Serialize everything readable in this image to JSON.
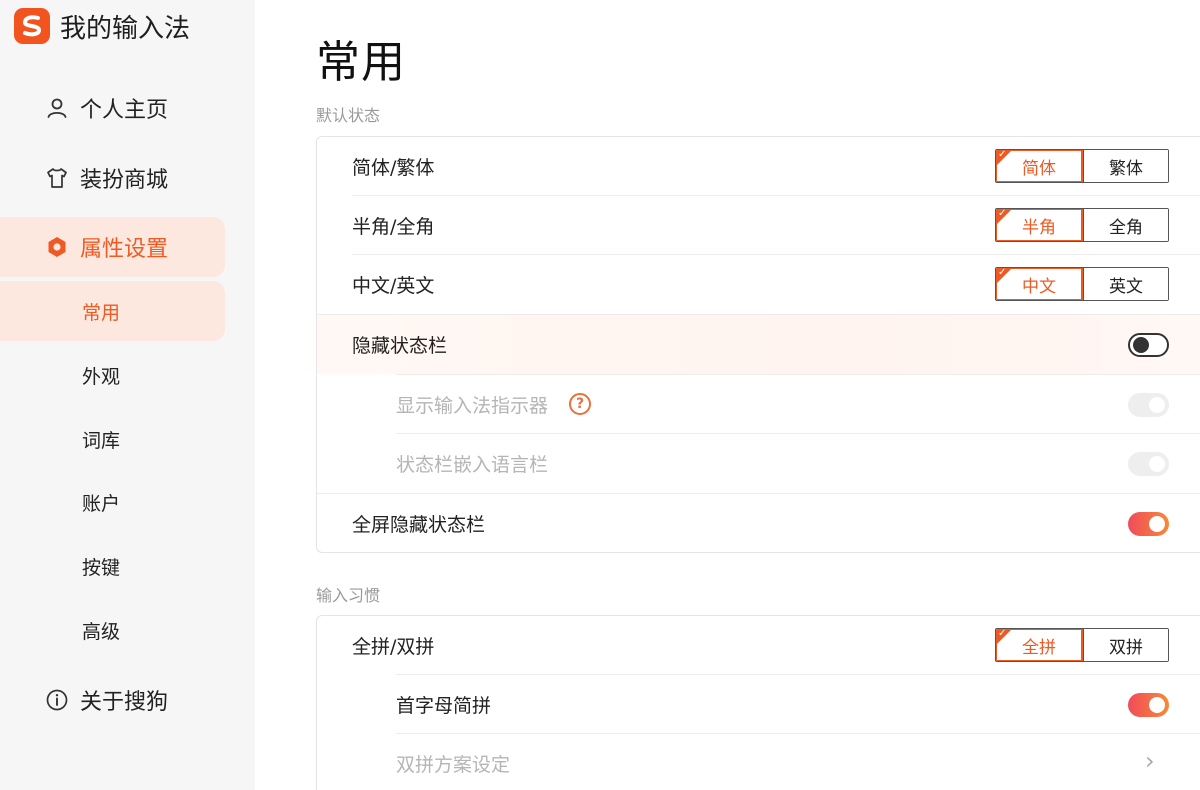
{
  "app": {
    "title": "我的输入法"
  },
  "sidebar": {
    "items": [
      {
        "label": "个人主页",
        "icon": "user-icon"
      },
      {
        "label": "装扮商城",
        "icon": "shirt-icon"
      },
      {
        "label": "属性设置",
        "icon": "hexagon-settings-icon"
      }
    ],
    "sub_items": [
      "常用",
      "外观",
      "词库",
      "账户",
      "按键",
      "高级"
    ],
    "about": {
      "label": "关于搜狗",
      "icon": "info-icon"
    }
  },
  "main": {
    "title": "常用",
    "sections": [
      {
        "label": "默认状态",
        "rows": [
          {
            "label": "简体/繁体",
            "options": [
              "简体",
              "繁体"
            ],
            "selected": 0
          },
          {
            "label": "半角/全角",
            "options": [
              "半角",
              "全角"
            ],
            "selected": 0
          },
          {
            "label": "中文/英文",
            "options": [
              "中文",
              "英文"
            ],
            "selected": 0
          },
          {
            "label": "隐藏状态栏",
            "toggle": false
          },
          {
            "label": "显示输入法指示器",
            "toggle": "disabled",
            "help": "?"
          },
          {
            "label": "状态栏嵌入语言栏",
            "toggle": "disabled"
          },
          {
            "label": "全屏隐藏状态栏",
            "toggle": true
          }
        ]
      },
      {
        "label": "输入习惯",
        "rows": [
          {
            "label": "全拼/双拼",
            "options": [
              "全拼",
              "双拼"
            ],
            "selected": 0
          },
          {
            "label": "首字母简拼",
            "toggle": true
          },
          {
            "label": "双拼方案设定",
            "chevron": "›"
          }
        ]
      }
    ]
  },
  "colors": {
    "accent": "#ee5a24",
    "toggle_on_start": "#f04b5c",
    "toggle_on_end": "#f78a36"
  }
}
